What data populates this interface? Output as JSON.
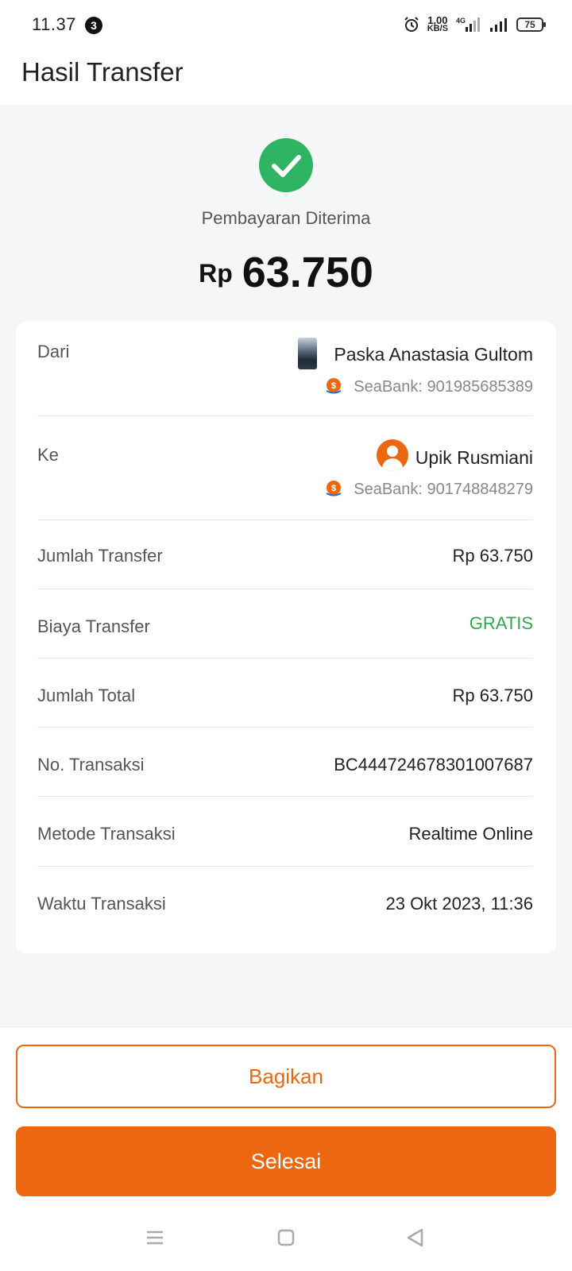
{
  "status_bar": {
    "time": "11.37",
    "notification_count": "3",
    "speed_value": "1,00",
    "speed_unit": "KB/S",
    "network": "4G",
    "battery": "75",
    "icons": [
      "alarm-icon",
      "signal-4g-icon",
      "signal-icon",
      "battery-icon"
    ]
  },
  "header": {
    "title": "Hasil Transfer"
  },
  "success": {
    "icon": "check-circle-icon",
    "message": "Pembayaran Diterima",
    "currency": "Rp",
    "amount": "63.750"
  },
  "transfer": {
    "from": {
      "label": "Dari",
      "name": "Paska Anastasia Gultom",
      "bank": "SeaBank: 901985685389"
    },
    "to": {
      "label": "Ke",
      "name": "Upik Rusmiani",
      "bank": "SeaBank: 901748848279"
    },
    "details": [
      {
        "label": "Jumlah Transfer",
        "value": "Rp 63.750"
      },
      {
        "label": "Biaya Transfer",
        "value": "GRATIS"
      },
      {
        "label": "Jumlah Total",
        "value": "Rp 63.750"
      },
      {
        "label": "No. Transaksi",
        "value": "BC444724678301007687"
      },
      {
        "label": "Metode Transaksi",
        "value": "Realtime Online"
      },
      {
        "label": "Waktu Transaksi",
        "value": "23 Okt 2023, 11:36"
      }
    ]
  },
  "actions": {
    "share_label": "Bagikan",
    "done_label": "Selesai"
  },
  "colors": {
    "accent": "#ed6610",
    "success": "#2fb463",
    "free_text": "#2fa84f"
  }
}
